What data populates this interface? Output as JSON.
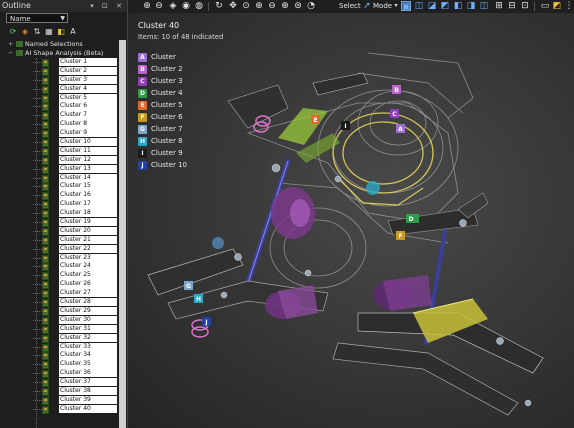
{
  "outline": {
    "title": "Outline",
    "window_controls": "▾ ⊡ ✕",
    "filter_select": "Name",
    "tools": [
      "⟳",
      "◈",
      "⇅",
      "▦",
      "◧",
      "A"
    ],
    "named_selections": "Named Selections",
    "analysis": "AI Shape Analysis (Beta)",
    "clusters": [
      "Cluster 1",
      "Cluster 2",
      "Cluster 3",
      "Cluster 4",
      "Cluster 5",
      "Cluster 6",
      "Cluster 7",
      "Cluster 8",
      "Cluster 9",
      "Cluster 10",
      "Cluster 11",
      "Cluster 12",
      "Cluster 13",
      "Cluster 14",
      "Cluster 15",
      "Cluster 16",
      "Cluster 17",
      "Cluster 18",
      "Cluster 19",
      "Cluster 20",
      "Cluster 21",
      "Cluster 22",
      "Cluster 23",
      "Cluster 24",
      "Cluster 25",
      "Cluster 26",
      "Cluster 27",
      "Cluster 28",
      "Cluster 29",
      "Cluster 30",
      "Cluster 31",
      "Cluster 32",
      "Cluster 33",
      "Cluster 34",
      "Cluster 35",
      "Cluster 36",
      "Cluster 37",
      "Cluster 38",
      "Cluster 39",
      "Cluster 40"
    ]
  },
  "toolbar": {
    "select_label": "Select",
    "mode_label": "Mode"
  },
  "viewport": {
    "title": "Cluster 40",
    "subtitle": "Items: 10 of 48 indicated",
    "legend": [
      {
        "letter": "A",
        "label": "Cluster",
        "color": "#9b6fd6"
      },
      {
        "letter": "B",
        "label": "Cluster 2",
        "color": "#b565c9"
      },
      {
        "letter": "C",
        "label": "Cluster 3",
        "color": "#8e3fb8"
      },
      {
        "letter": "D",
        "label": "Cluster 4",
        "color": "#2e9a4a"
      },
      {
        "letter": "E",
        "label": "Cluster 5",
        "color": "#e06a2a"
      },
      {
        "letter": "F",
        "label": "Cluster 6",
        "color": "#c89a1e"
      },
      {
        "letter": "G",
        "label": "Cluster 7",
        "color": "#7fa6c9"
      },
      {
        "letter": "H",
        "label": "Cluster 8",
        "color": "#2aa7c4"
      },
      {
        "letter": "I",
        "label": "Cluster 9",
        "color": "#1b1b1b"
      },
      {
        "letter": "J",
        "label": "Cluster 10",
        "color": "#2440a0"
      }
    ],
    "markers": [
      "A",
      "B",
      "C",
      "D",
      "E",
      "F",
      "G",
      "H",
      "I",
      "J"
    ]
  }
}
